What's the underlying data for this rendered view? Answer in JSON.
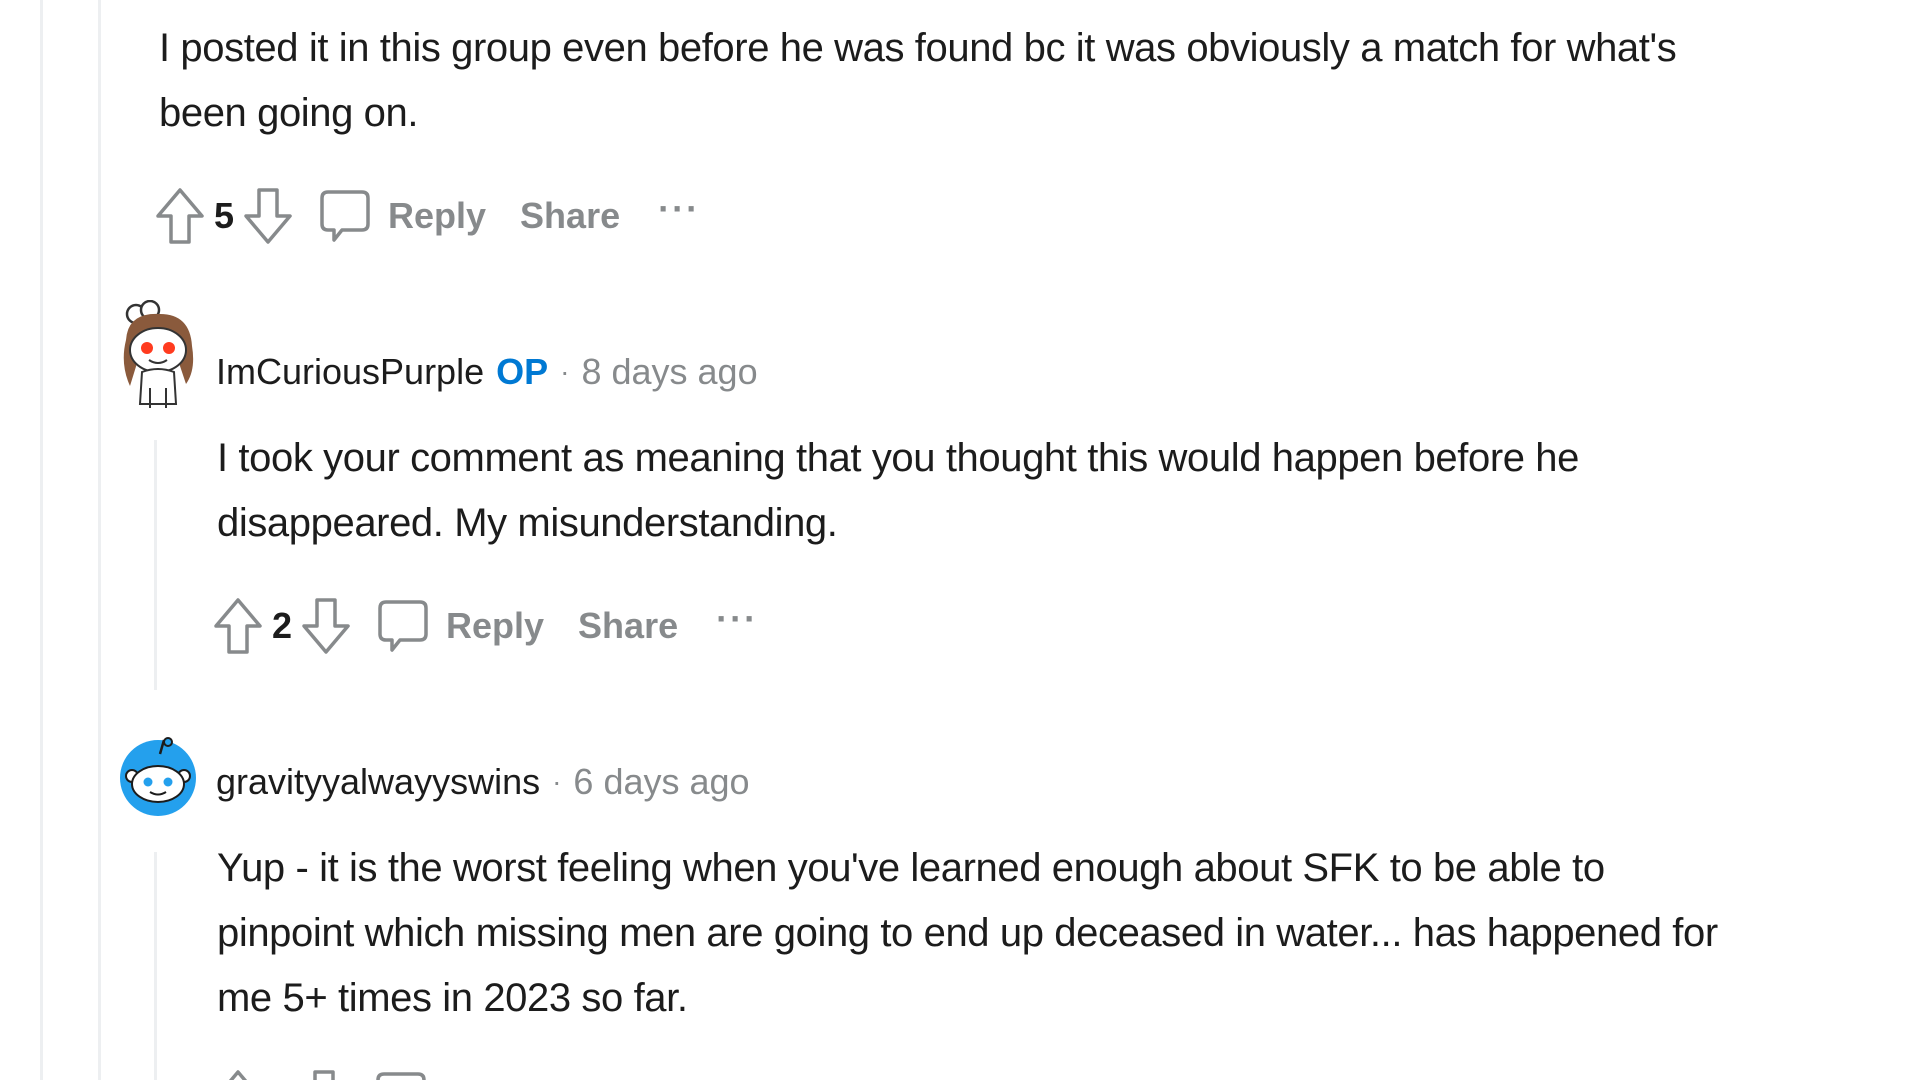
{
  "comments": [
    {
      "body_lines": [
        "I posted it in this group even before he was found bc it was obviously a match for what's",
        "been going on."
      ],
      "score": "5",
      "reply_label": "Reply",
      "share_label": "Share",
      "more_label": "···"
    },
    {
      "username": "ImCuriousPurple",
      "op_badge": "OP",
      "separator": "·",
      "time": "8 days ago",
      "body_lines": [
        "I took your comment as meaning that you thought this would happen before he",
        "disappeared. My misunderstanding."
      ],
      "score": "2",
      "reply_label": "Reply",
      "share_label": "Share",
      "more_label": "···"
    },
    {
      "username": "gravityyalwayyswins",
      "separator": "·",
      "time": "6 days ago",
      "body_lines": [
        "Yup - it is the worst feeling when you've learned enough about SFK to be able to",
        "pinpoint which missing men are going to end up deceased in water... has happened for",
        "me 5+ times in 2023 so far."
      ]
    }
  ],
  "icons": {
    "upvote": "arrow-up-icon",
    "downvote": "arrow-down-icon",
    "reply": "speech-bubble-icon",
    "avatar_1": "snoo-avatar-brown-hair",
    "avatar_2": "snoo-avatar-blue"
  },
  "colors": {
    "op_badge": "#0079d3",
    "meta_text": "#878a8c",
    "body_text": "#1c1c1c",
    "thread_line": "#edeff1",
    "avatar_blue": "#24a0ed"
  }
}
